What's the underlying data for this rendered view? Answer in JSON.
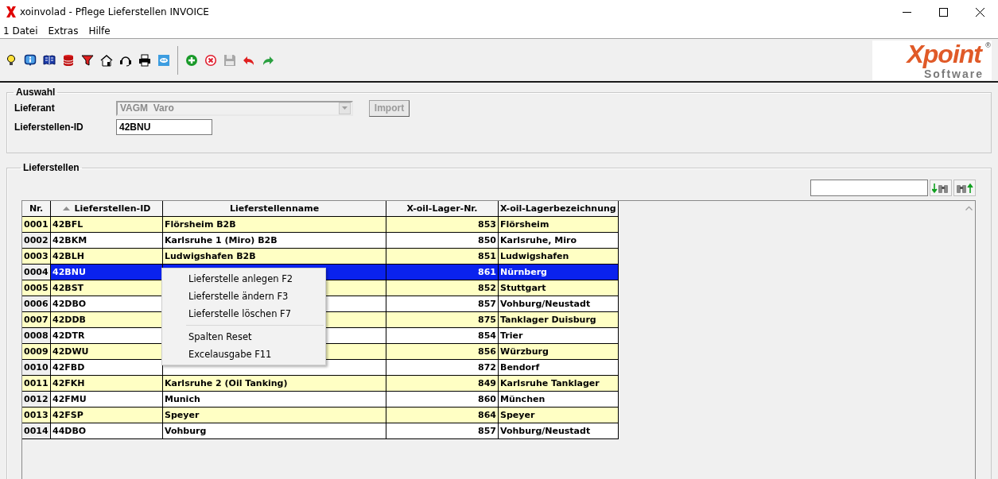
{
  "window": {
    "title": "xoinvolad - Pflege Lieferstellen INVOICE"
  },
  "menu": [
    "1 Datei",
    "Extras",
    "Hilfe"
  ],
  "logo": {
    "name": "Xpoint",
    "sub": "Software",
    "mark": "®"
  },
  "auswahl": {
    "title": "Auswahl",
    "lieferant": {
      "label": "Lieferant",
      "value": "VAGM  Varo",
      "disabled": true
    },
    "import_button": {
      "label": "Import",
      "disabled": true
    },
    "id_field": {
      "label": "Lieferstellen-ID",
      "value": "42BNU"
    }
  },
  "lieferstellen": {
    "title": "Lieferstellen",
    "table": {
      "columns": [
        {
          "label": "Nr.",
          "sorted": false,
          "kind": "text"
        },
        {
          "label": "Lieferstellen-ID",
          "sorted": true,
          "kind": "text"
        },
        {
          "label": "Lieferstellenname",
          "sorted": false,
          "kind": "text"
        },
        {
          "label": "X-oil-Lager-Nr.",
          "sorted": false,
          "kind": "number"
        },
        {
          "label": "X-oil-Lagerbezeichnung",
          "sorted": false,
          "kind": "text"
        }
      ],
      "rows": [
        {
          "cells": [
            "0001",
            "42BFL",
            "Flörsheim B2B",
            "853",
            "Flörsheim"
          ],
          "shaded": true,
          "selected": false
        },
        {
          "cells": [
            "0002",
            "42BKM",
            "Karlsruhe 1 (Miro) B2B",
            "850",
            "Karlsruhe, Miro"
          ],
          "shaded": false,
          "selected": false
        },
        {
          "cells": [
            "0003",
            "42BLH",
            "Ludwigshafen B2B",
            "851",
            "Ludwigshafen"
          ],
          "shaded": true,
          "selected": false
        },
        {
          "cells": [
            "0004",
            "42BNU",
            null,
            "861",
            "Nürnberg"
          ],
          "shaded": false,
          "selected": true
        },
        {
          "cells": [
            "0005",
            "42BST",
            null,
            "852",
            "Stuttgart"
          ],
          "shaded": true,
          "selected": false
        },
        {
          "cells": [
            "0006",
            "42DBO",
            null,
            "857",
            "Vohburg/Neustadt"
          ],
          "shaded": false,
          "selected": false
        },
        {
          "cells": [
            "0007",
            "42DDB",
            null,
            "875",
            "Tanklager Duisburg"
          ],
          "shaded": true,
          "selected": false
        },
        {
          "cells": [
            "0008",
            "42DTR",
            null,
            "854",
            "Trier"
          ],
          "shaded": false,
          "selected": false
        },
        {
          "cells": [
            "0009",
            "42DWU",
            null,
            "856",
            "Würzburg"
          ],
          "shaded": true,
          "selected": false
        },
        {
          "cells": [
            "0010",
            "42FBD",
            null,
            "872",
            "Bendorf"
          ],
          "shaded": false,
          "selected": false
        },
        {
          "cells": [
            "0011",
            "42FKH",
            "Karlsruhe 2 (Oil Tanking)",
            "849",
            "Karlsruhe Tanklager"
          ],
          "shaded": true,
          "selected": false
        },
        {
          "cells": [
            "0012",
            "42FMU",
            "Munich",
            "860",
            "München"
          ],
          "shaded": false,
          "selected": false
        },
        {
          "cells": [
            "0013",
            "42FSP",
            "Speyer",
            "864",
            "Speyer"
          ],
          "shaded": true,
          "selected": false
        },
        {
          "cells": [
            "0014",
            "44DBO",
            "Vohburg",
            "857",
            "Vohburg/Neustadt"
          ],
          "shaded": false,
          "selected": false
        }
      ]
    }
  },
  "context_menu": [
    {
      "kind": "item",
      "label": "Lieferstelle anlegen F2"
    },
    {
      "kind": "item",
      "label": "Lieferstelle ändern F3"
    },
    {
      "kind": "item",
      "label": "Lieferstelle löschen F7"
    },
    {
      "kind": "separator"
    },
    {
      "kind": "item",
      "label": "Spalten Reset"
    },
    {
      "kind": "item",
      "label": "Excelausgabe F11"
    }
  ]
}
